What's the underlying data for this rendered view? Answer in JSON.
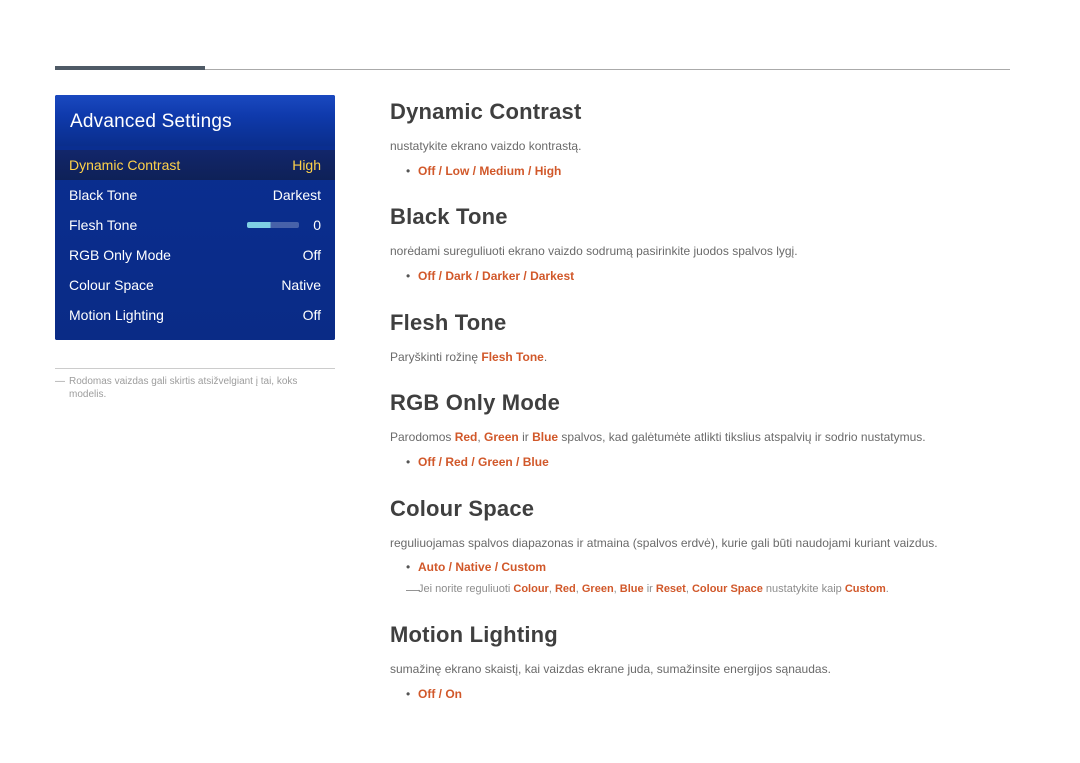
{
  "osd": {
    "title": "Advanced Settings",
    "rows": [
      {
        "label": "Dynamic Contrast",
        "value": "High",
        "selected": true
      },
      {
        "label": "Black Tone",
        "value": "Darkest"
      },
      {
        "label": "Flesh Tone",
        "value": "0",
        "slider": true
      },
      {
        "label": "RGB Only Mode",
        "value": "Off"
      },
      {
        "label": "Colour Space",
        "value": "Native"
      },
      {
        "label": "Motion Lighting",
        "value": "Off"
      }
    ]
  },
  "caption_dash": "―",
  "caption_text": "Rodomas vaizdas gali skirtis atsižvelgiant į tai, koks modelis.",
  "sections": {
    "dc": {
      "title": "Dynamic Contrast",
      "desc": "nustatykite ekrano vaizdo kontrastą.",
      "opts": [
        "Off",
        "Low",
        "Medium",
        "High"
      ]
    },
    "bt": {
      "title": "Black Tone",
      "desc": "norėdami sureguliuoti ekrano vaizdo sodrumą pasirinkite juodos spalvos lygį.",
      "opts": [
        "Off",
        "Dark",
        "Darker",
        "Darkest"
      ]
    },
    "ft": {
      "title": "Flesh Tone",
      "desc_pre": "Paryškinti rožinę ",
      "desc_hl": "Flesh Tone",
      "desc_suf": "."
    },
    "rgb": {
      "title": "RGB Only Mode",
      "desc_pre": "Parodomos ",
      "r": "Red",
      "c1": ", ",
      "g": "Green",
      "ir": " ir ",
      "b": "Blue",
      "desc_suf": " spalvos, kad galėtumėte atlikti tikslius atspalvių ir sodrio nustatymus.",
      "opts": [
        "Off",
        "Red",
        "Green",
        "Blue"
      ]
    },
    "cs": {
      "title": "Colour Space",
      "desc": "reguliuojamas spalvos diapazonas ir atmaina (spalvos erdvė), kurie gali būti naudojami kuriant vaizdus.",
      "opts": [
        "Auto",
        "Native",
        "Custom"
      ],
      "note_pre": "Jei norite reguliuoti ",
      "note_items": [
        "Colour",
        "Red",
        "Green",
        "Blue"
      ],
      "note_ir": " ir ",
      "note_reset": "Reset",
      "note_mid": ", ",
      "note_cs": "Colour Space",
      "note_set": " nustatykite kaip ",
      "note_custom": "Custom",
      "note_end": "."
    },
    "ml": {
      "title": "Motion Lighting",
      "desc": "sumažinę ekrano skaistį, kai vaizdas ekrane juda, sumažinsite energijos sąnaudas.",
      "opts": [
        "Off",
        "On"
      ]
    }
  },
  "slash": " / "
}
